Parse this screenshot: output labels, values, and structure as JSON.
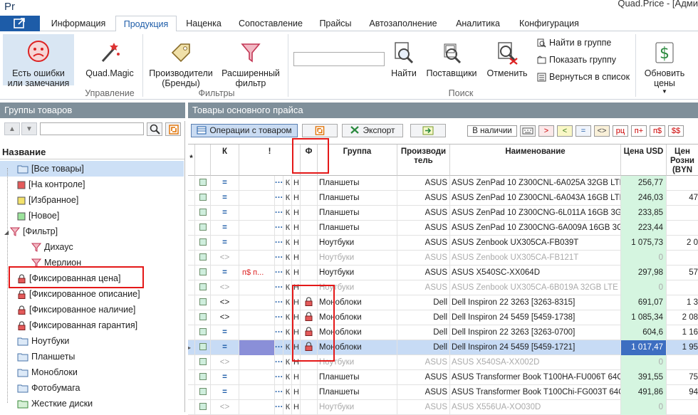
{
  "app": {
    "logo": "Pr",
    "title": "Quad.Price - [Адми"
  },
  "tabs": [
    "Информация",
    "Продукция",
    "Наценка",
    "Сопоставление",
    "Прайсы",
    "Автозаполнение",
    "Аналитика",
    "Конфигурация"
  ],
  "ribbon": {
    "errors_btn": "Есть ошибки\nили замечания",
    "quad_magic": "Quad.Magic",
    "group_manage": "Управление",
    "brands_btn": "Производители\n(Бренды)",
    "ext_filter_btn": "Расширенный\nфильтр",
    "group_filters": "Фильтры",
    "search_placeholder": "",
    "find_btn": "Найти",
    "suppliers_btn": "Поставщики",
    "cancel_btn": "Отменить",
    "find_in_group": "Найти в группе",
    "show_group": "Показать группу",
    "back_to_list": "Вернуться в список",
    "group_search": "Поиск",
    "update_prices": "Обновить\nцены"
  },
  "left": {
    "header": "Группы товаров",
    "tree_header": "Название",
    "nodes": [
      "[Все товары]",
      "[На контроле]",
      "[Избранное]",
      "[Новое]",
      "[Фильтр]",
      "Дихаус",
      "Мерлион",
      "[Фиксированная цена]",
      "[Фиксированное описание]",
      "[Фиксированное наличие]",
      "[Фиксированная гарантия]",
      "Ноутбуки",
      "Планшеты",
      "Моноблоки",
      "Фотобумага",
      "Жесткие диски"
    ]
  },
  "right": {
    "header": "Товары основного прайса",
    "ops_btn": "Операции с товаром",
    "export_btn": "Экспорт",
    "in_stock_btn": "В наличии",
    "filter_btns": [
      ">",
      "<",
      "=",
      "<>",
      "рц",
      "п+",
      "п$",
      "$$"
    ],
    "col_headers": {
      "star": "*",
      "k": "К",
      "excl": "!",
      "f": "Ф",
      "group": "Группа",
      "mfr": "Производи\nтель",
      "name": "Наименование",
      "price": "Цена USD",
      "retail": "Цен\nРозни\n(BYN"
    }
  },
  "rows": [
    {
      "op": "=",
      "excl": "",
      "lock": false,
      "group": "Планшеты",
      "mfr": "ASUS",
      "name": "ASUS ZenPad 10 Z300CNL-6A025A 32GB LTE ...",
      "price": "256,77",
      "retail": "",
      "dim": false,
      "sel": false
    },
    {
      "op": "=",
      "excl": "",
      "lock": false,
      "group": "Планшеты",
      "mfr": "ASUS",
      "name": "ASUS ZenPad 10 Z300CNL-6A043A 16GB LTE ...",
      "price": "246,03",
      "retail": "47",
      "dim": false,
      "sel": false
    },
    {
      "op": "=",
      "excl": "",
      "lock": false,
      "group": "Планшеты",
      "mfr": "ASUS",
      "name": "ASUS ZenPad 10 Z300CNG-6L011A 16GB 3G R...",
      "price": "233,85",
      "retail": "",
      "dim": false,
      "sel": false
    },
    {
      "op": "=",
      "excl": "",
      "lock": false,
      "group": "Планшеты",
      "mfr": "ASUS",
      "name": "ASUS ZenPad 10 Z300CNG-6A009A 16GB 3G D...",
      "price": "223,44",
      "retail": "",
      "dim": false,
      "sel": false
    },
    {
      "op": "=",
      "excl": "",
      "lock": false,
      "group": "Ноутбуки",
      "mfr": "ASUS",
      "name": "ASUS Zenbook UX305CA-FB039T",
      "price": "1 075,73",
      "retail": "2 0",
      "dim": false,
      "sel": false
    },
    {
      "op": "<>",
      "excl": "",
      "lock": false,
      "group": "Ноутбуки",
      "mfr": "ASUS",
      "name": "ASUS Zenbook UX305CA-FB121T",
      "price": "0",
      "retail": "",
      "dim": true,
      "sel": false
    },
    {
      "op": "=",
      "excl": "п$ п...",
      "lock": false,
      "group": "Ноутбуки",
      "mfr": "ASUS",
      "name": "ASUS X540SC-XX064D",
      "price": "297,98",
      "retail": "57",
      "dim": false,
      "sel": false
    },
    {
      "op": "<>",
      "excl": "",
      "lock": false,
      "group": "Ноутбуки",
      "mfr": "ASUS",
      "name": "ASUS Zenbook UX305CA-6B019A 32GB LTE ...",
      "price": "0",
      "retail": "",
      "dim": true,
      "sel": false
    },
    {
      "op": "<>",
      "excl": "",
      "lock": true,
      "group": "Моноблоки",
      "mfr": "Dell",
      "name": "Dell Inspiron 22 3263 [3263-8315]",
      "price": "691,07",
      "retail": "1 3",
      "dim": false,
      "sel": false
    },
    {
      "op": "<>",
      "excl": "",
      "lock": true,
      "group": "Моноблоки",
      "mfr": "Dell",
      "name": "Dell Inspiron 24 5459 [5459-1738]",
      "price": "1 085,34",
      "retail": "2 08",
      "dim": false,
      "sel": false
    },
    {
      "op": "=",
      "excl": "",
      "lock": true,
      "group": "Моноблоки",
      "mfr": "Dell",
      "name": "Dell Inspiron 22 3263 [3263-0700]",
      "price": "604,6",
      "retail": "1 16",
      "dim": false,
      "sel": false
    },
    {
      "op": "=",
      "excl": "",
      "lock": true,
      "group": "Моноблоки",
      "mfr": "Dell",
      "name": "Dell Inspiron 24 5459 [5459-1721]",
      "price": "1 017,47",
      "retail": "1 95",
      "dim": false,
      "sel": true
    },
    {
      "op": "<>",
      "excl": "",
      "lock": false,
      "group": "Ноутбуки",
      "mfr": "ASUS",
      "name": "ASUS X540SA-XX002D",
      "price": "0",
      "retail": "",
      "dim": true,
      "sel": false
    },
    {
      "op": "=",
      "excl": "",
      "lock": false,
      "group": "Планшеты",
      "mfr": "ASUS",
      "name": "ASUS Transformer Book T100HA-FU006T 64GB...",
      "price": "391,55",
      "retail": "75",
      "dim": false,
      "sel": false
    },
    {
      "op": "=",
      "excl": "",
      "lock": false,
      "group": "Планшеты",
      "mfr": "ASUS",
      "name": "ASUS Transformer Book T100Chi-FG003T 64GB...",
      "price": "491,86",
      "retail": "94",
      "dim": false,
      "sel": false
    },
    {
      "op": "<>",
      "excl": "",
      "lock": false,
      "group": "Ноутбуки",
      "mfr": "ASUS",
      "name": "ASUS X556UA-XO030D",
      "price": "0",
      "retail": "",
      "dim": true,
      "sel": false
    }
  ]
}
